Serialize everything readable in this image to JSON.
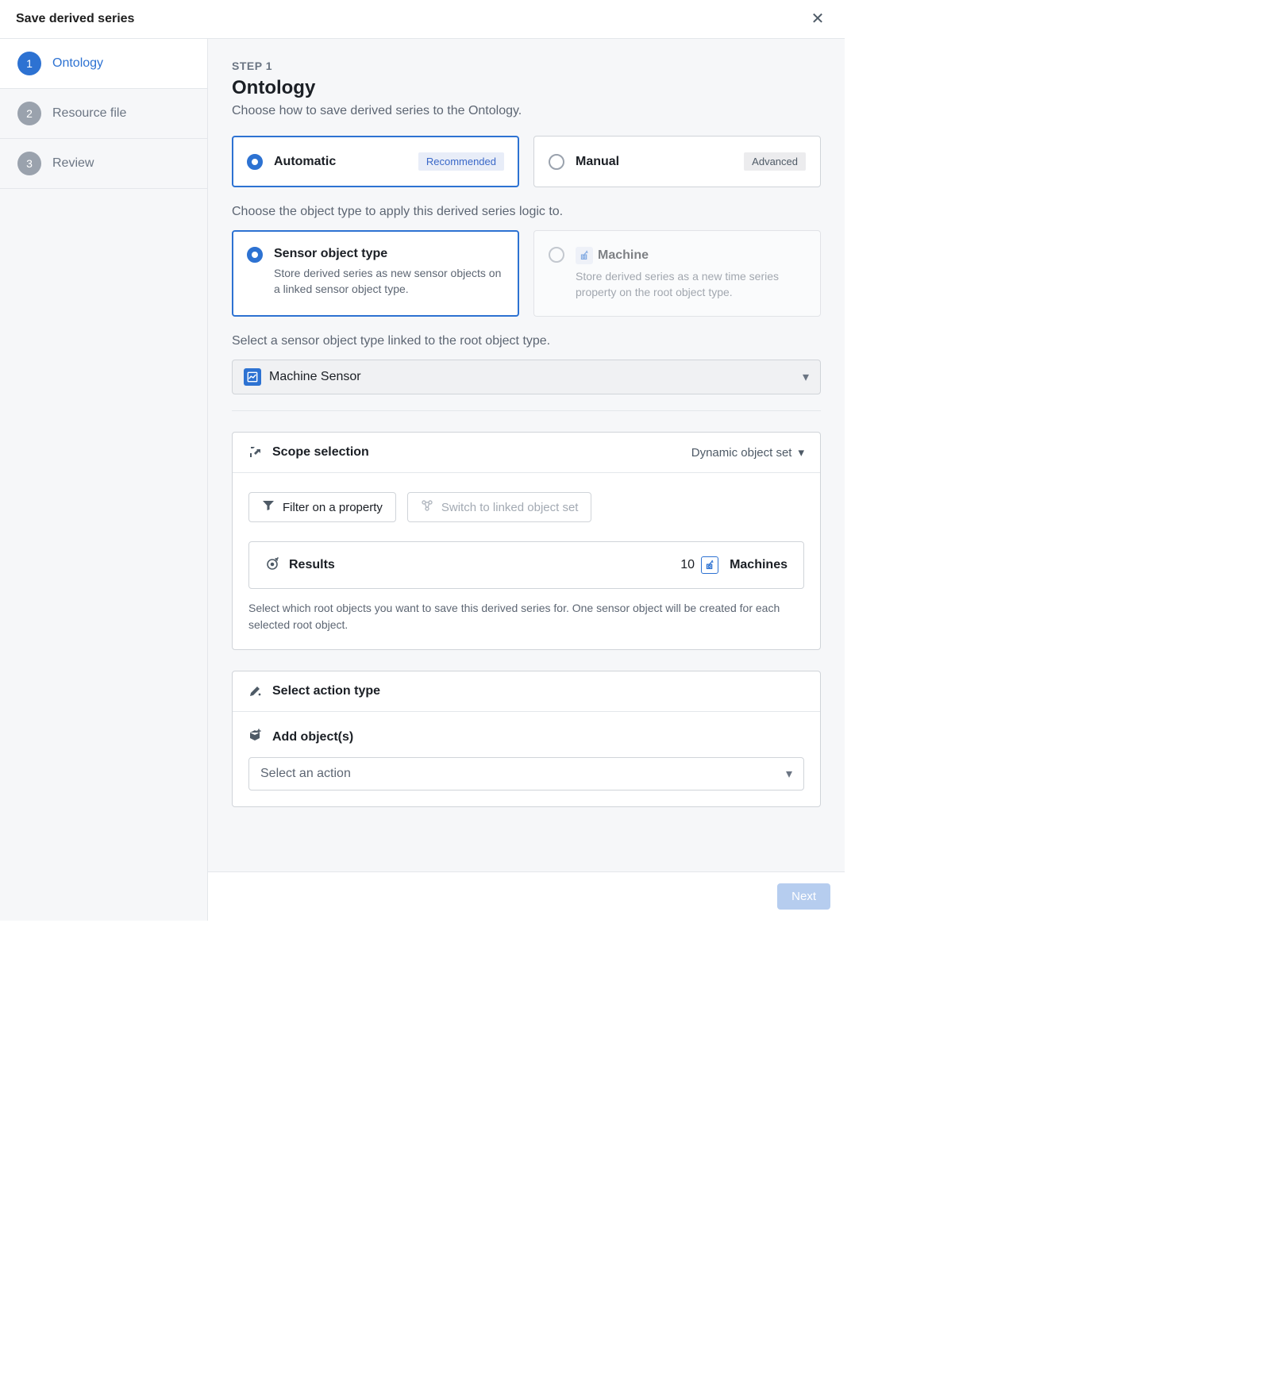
{
  "modal": {
    "title": "Save derived series"
  },
  "steps": [
    {
      "num": "1",
      "label": "Ontology"
    },
    {
      "num": "2",
      "label": "Resource file"
    },
    {
      "num": "3",
      "label": "Review"
    }
  ],
  "page": {
    "eyebrow": "STEP 1",
    "heading": "Ontology",
    "sub": "Choose how to save derived series to the Ontology."
  },
  "mode": {
    "auto": {
      "label": "Automatic",
      "badge": "Recommended"
    },
    "manual": {
      "label": "Manual",
      "badge": "Advanced"
    }
  },
  "objectTypePrompt": "Choose the object type to apply this derived series logic to.",
  "objectType": {
    "sensor": {
      "title": "Sensor object type",
      "desc": "Store derived series as new sensor objects on a linked sensor object type."
    },
    "machine": {
      "title": "Machine",
      "desc": "Store derived series as a new time series property on the root object type."
    }
  },
  "sensorSelectPrompt": "Select a sensor object type linked to the root object type.",
  "sensorSelect": {
    "value": "Machine Sensor"
  },
  "scope": {
    "title": "Scope selection",
    "mode": "Dynamic object set",
    "filterBtn": "Filter on a property",
    "switchBtn": "Switch to linked object set",
    "resultsLabel": "Results",
    "resultsCount": "10",
    "resultsType": "Machines",
    "hint": "Select which root objects you want to save this derived series for. One sensor object will be created for each selected root object."
  },
  "action": {
    "title": "Select action type",
    "addLabel": "Add object(s)",
    "selectPlaceholder": "Select an action"
  },
  "footer": {
    "next": "Next"
  }
}
